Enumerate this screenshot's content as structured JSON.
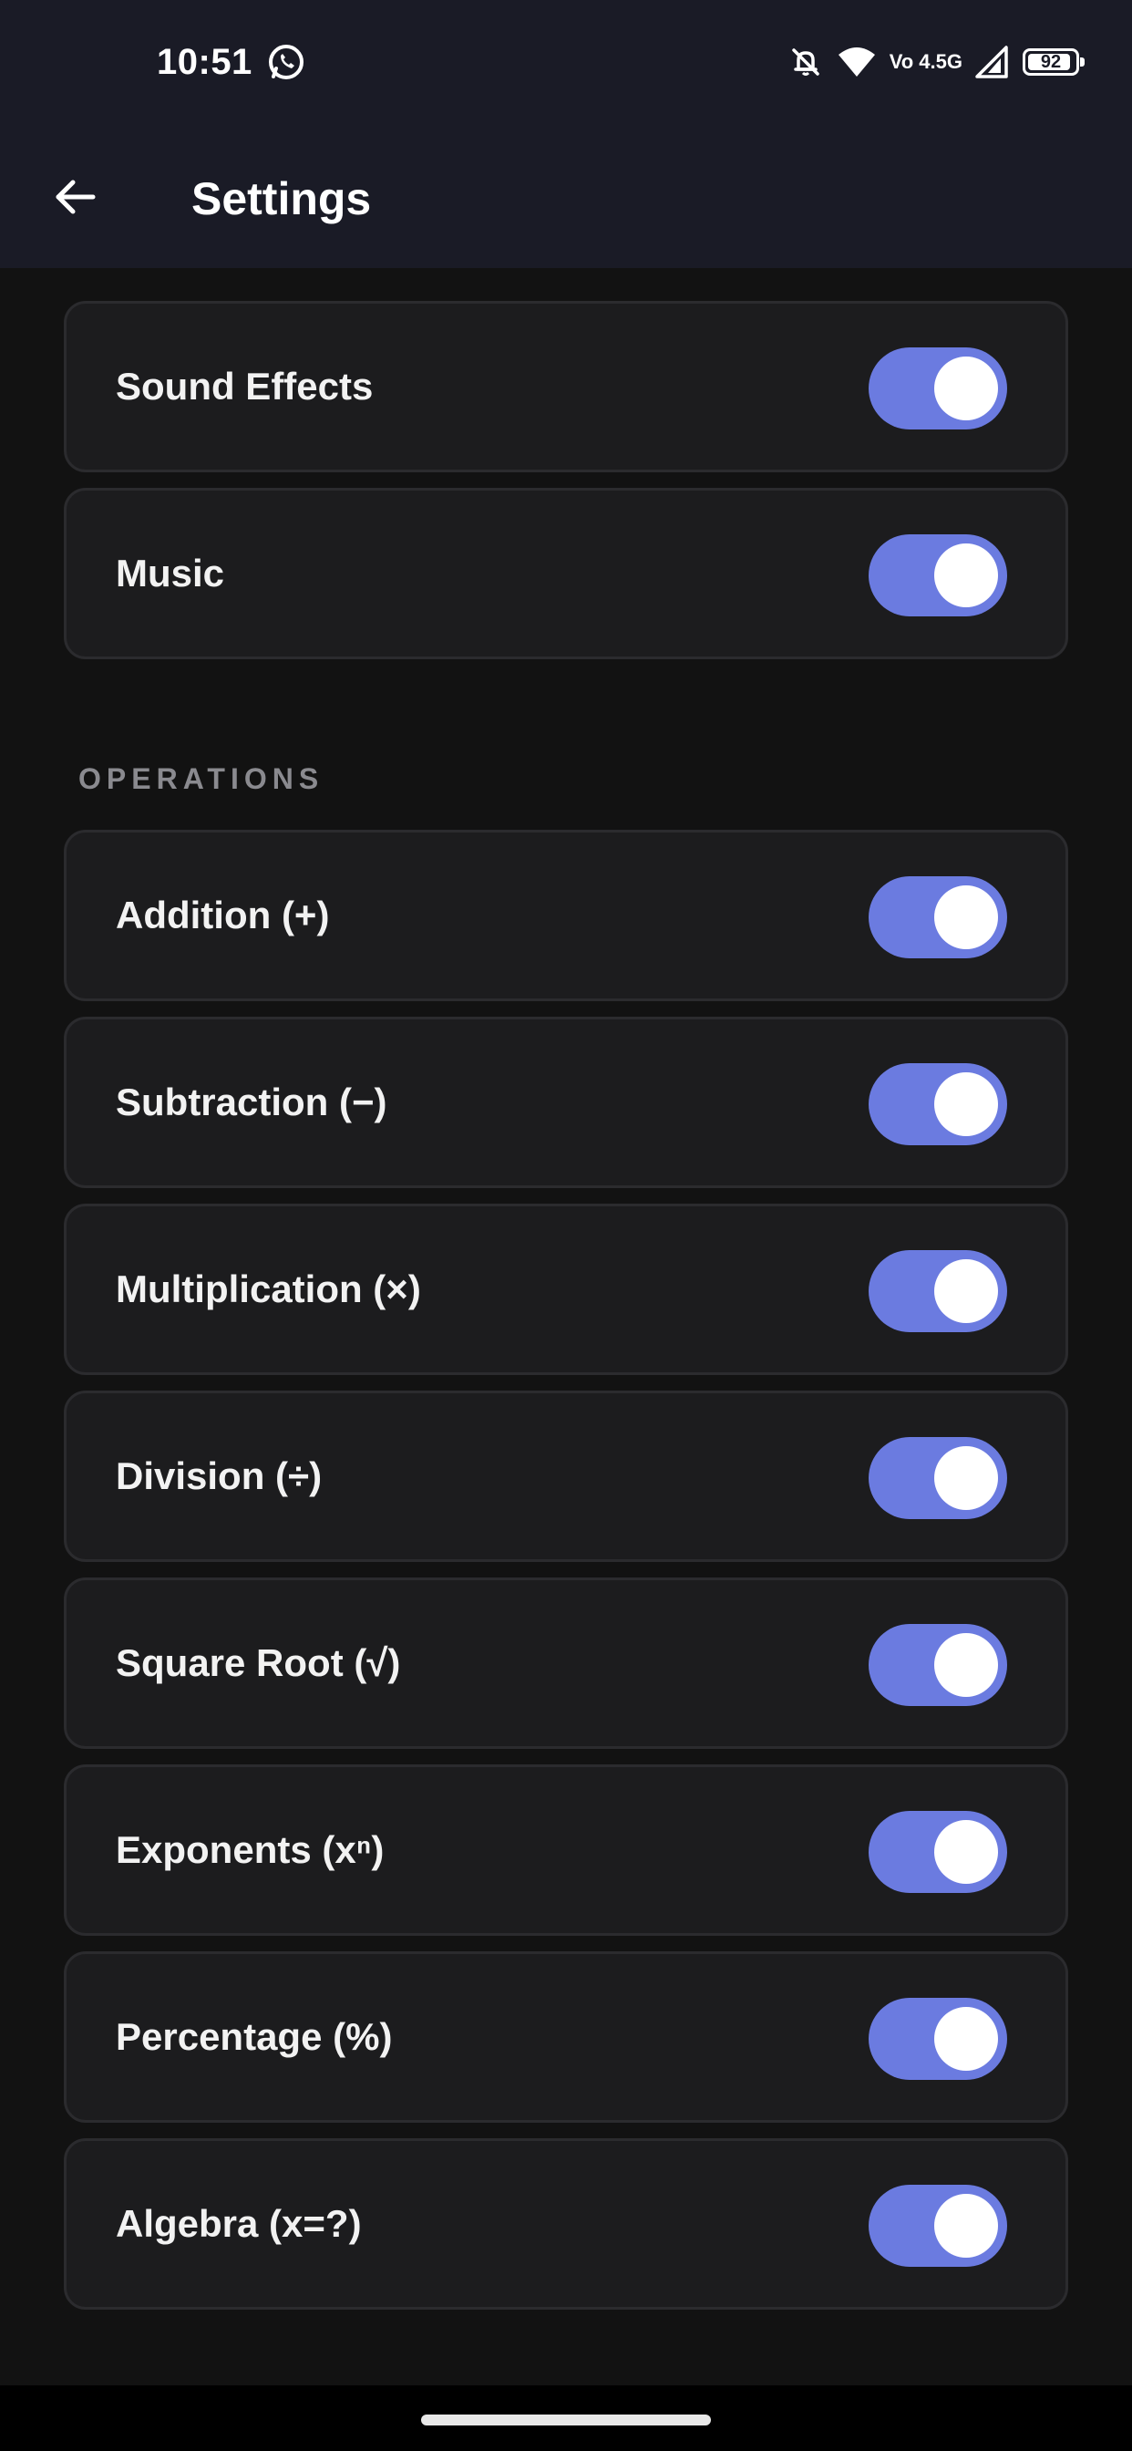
{
  "status_bar": {
    "time": "10:51",
    "network_text": "Vo 4.5G",
    "battery_level": "92"
  },
  "app_bar": {
    "title": "Settings"
  },
  "general_settings": [
    {
      "label": "Sound Effects",
      "enabled": true
    },
    {
      "label": "Music",
      "enabled": true
    }
  ],
  "operations_section": {
    "header": "OPERATIONS",
    "items": [
      {
        "label": "Addition (+)",
        "enabled": true
      },
      {
        "label": "Subtraction (−)",
        "enabled": true
      },
      {
        "label": "Multiplication (×)",
        "enabled": true
      },
      {
        "label": "Division (÷)",
        "enabled": true
      },
      {
        "label": "Square Root (√)",
        "enabled": true
      },
      {
        "label": "Exponents (xⁿ)",
        "enabled": true
      },
      {
        "label": "Percentage (%)",
        "enabled": true
      },
      {
        "label": "Algebra (x=?)",
        "enabled": true
      }
    ]
  },
  "colors": {
    "accent": "#6b7be0",
    "app_bar": "#1a1b26",
    "background": "#121212",
    "card": "#1c1c1e"
  }
}
